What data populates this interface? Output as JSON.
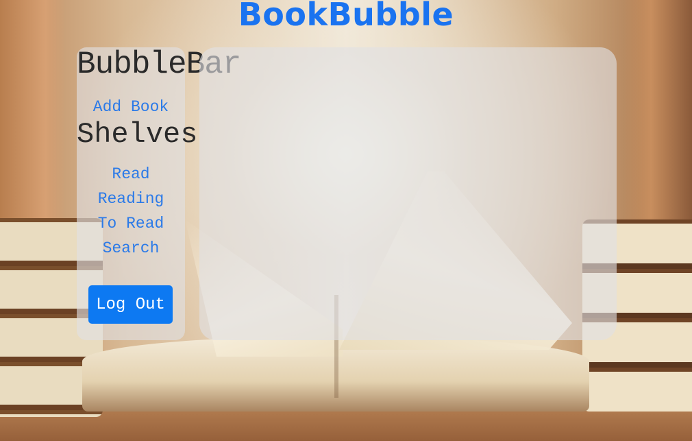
{
  "header": {
    "brand": "BookBubble"
  },
  "sidebar": {
    "title": "BubbleBar",
    "add_book": "Add Book",
    "shelves_heading": "Shelves",
    "shelves": [
      {
        "label": "Read"
      },
      {
        "label": "Reading"
      },
      {
        "label": "To Read"
      },
      {
        "label": "Search"
      }
    ],
    "logout_label": "Log Out"
  },
  "colors": {
    "brand": "#1a73f0",
    "link": "#2b7ae8",
    "button": "#0d79f2",
    "panel": "rgba(225,225,228,0.62)"
  }
}
